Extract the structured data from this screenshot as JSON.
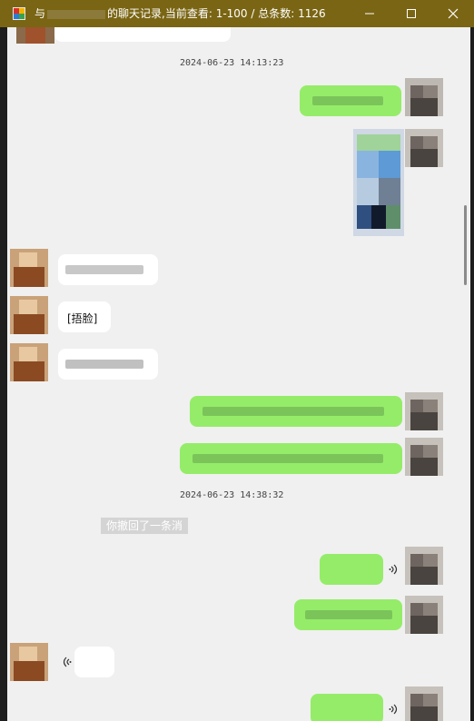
{
  "window": {
    "title_prefix": "与",
    "title_suffix": "的聊天记录,当前查看: 1-100 / 总条数: 1126"
  },
  "messages": {
    "timestamp_1": "2024-06-23 14:13:23",
    "timestamp_2": "2024-06-23 14:38:32",
    "emoji_text": "[捂脸]",
    "recall_notice": "你撤回了一条消"
  },
  "icons": {
    "minimize": "minimize-icon",
    "maximize": "maximize-icon",
    "close": "close-icon",
    "voice": "voice-wave-icon"
  },
  "colors": {
    "titlebar": "#7a6514",
    "bubble_self": "#95ec69",
    "bubble_other": "#ffffff",
    "background": "#f0f0f0"
  }
}
